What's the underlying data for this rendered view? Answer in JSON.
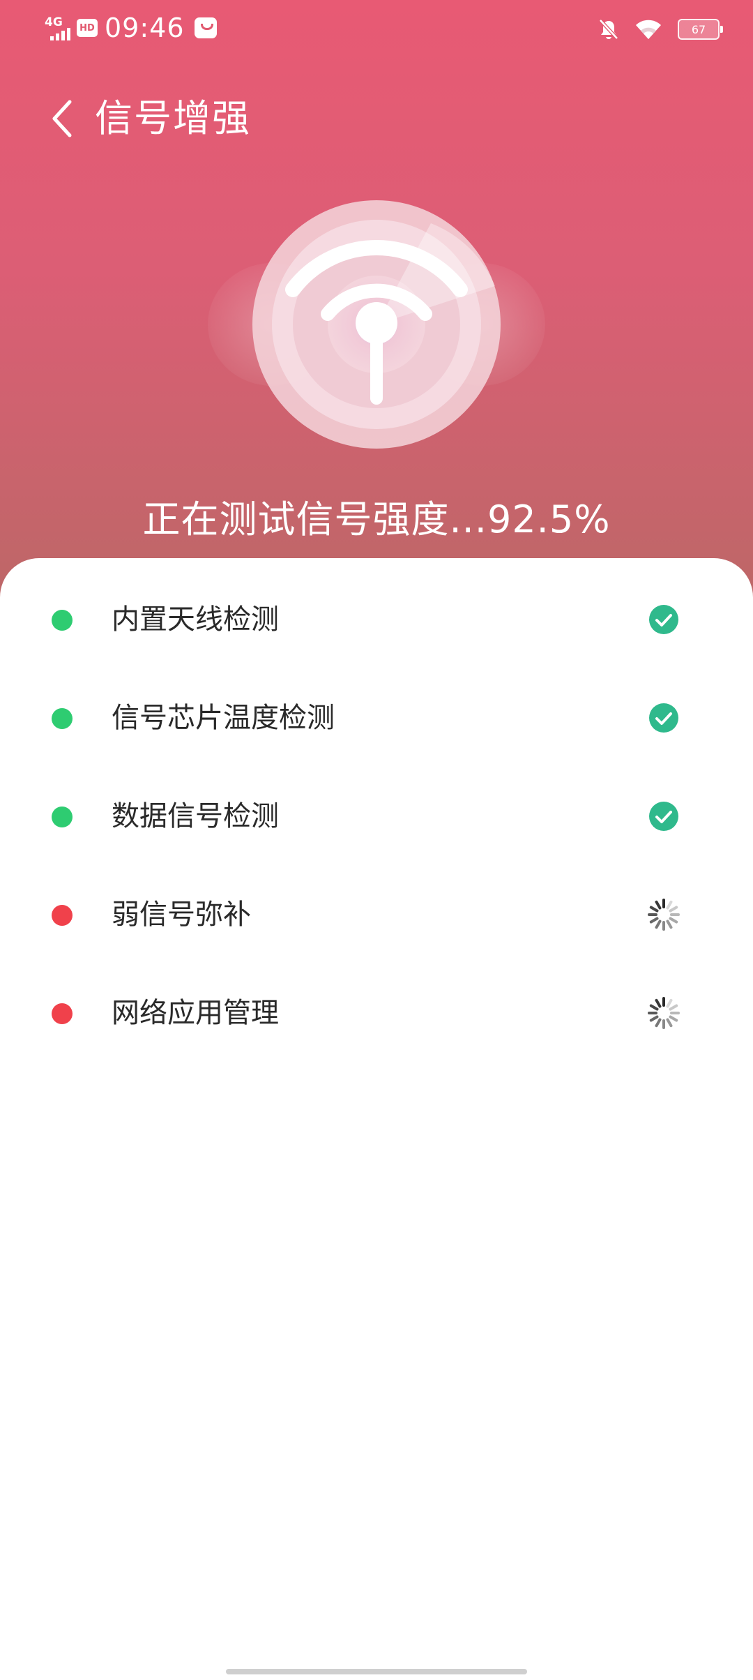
{
  "status_bar": {
    "network": "4G",
    "hd": "HD",
    "time": "09:46",
    "battery": "67"
  },
  "header": {
    "title": "信号增强"
  },
  "progress": {
    "text": "正在测试信号强度...92.5%",
    "percent": 92.5
  },
  "colors": {
    "hero_top": "#e85a74",
    "hero_bottom": "#bd6767",
    "done": "#2ecc71",
    "pending": "#f0414b",
    "check_badge": "#2fb98c"
  },
  "checks": [
    {
      "label": "内置天线检测",
      "state": "done",
      "icon": "check-circle-icon"
    },
    {
      "label": "信号芯片温度检测",
      "state": "done",
      "icon": "check-circle-icon"
    },
    {
      "label": "数据信号检测",
      "state": "done",
      "icon": "check-circle-icon"
    },
    {
      "label": "弱信号弥补",
      "state": "pending",
      "icon": "spinner-icon"
    },
    {
      "label": "网络应用管理",
      "state": "pending",
      "icon": "spinner-icon"
    }
  ]
}
